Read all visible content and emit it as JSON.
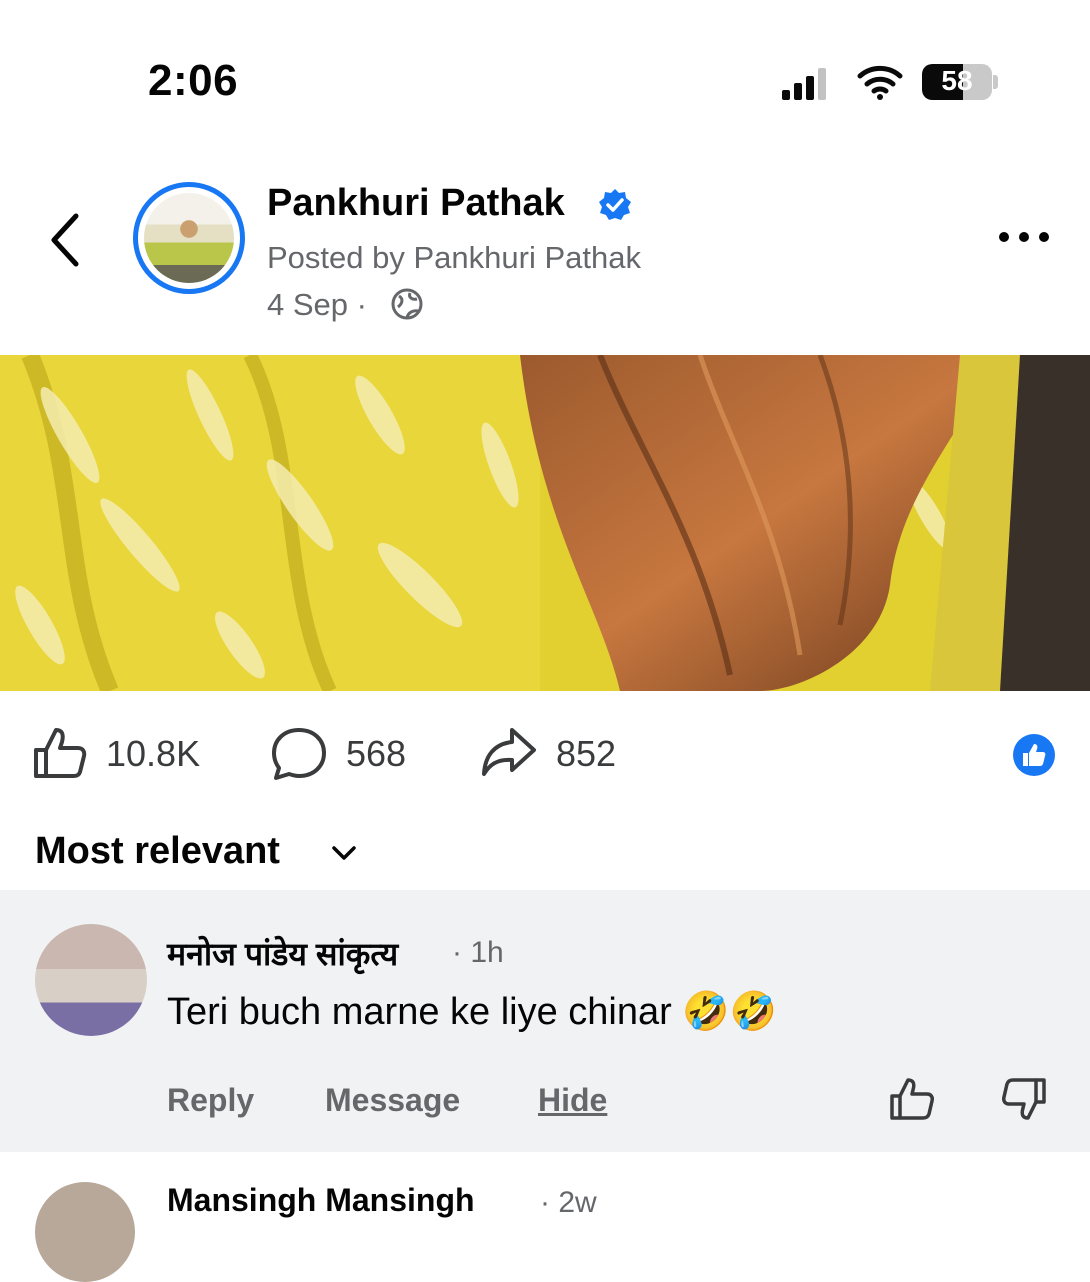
{
  "status_bar": {
    "time": "2:06",
    "battery": "58",
    "battery_level": 0.58,
    "icons": [
      "cellular-signal-icon",
      "wifi-icon",
      "battery-icon"
    ]
  },
  "header": {
    "page_name": "Pankhuri Pathak",
    "verified": true,
    "posted_by": "Posted by Pankhuri Pathak",
    "date": "4 Sep ·",
    "audience_icon": "globe-icon",
    "accent": "#1877f2"
  },
  "actions": {
    "likes": "10.8K",
    "comments": "568",
    "shares": "852"
  },
  "sort": {
    "label": "Most relevant"
  },
  "comments": [
    {
      "author": "मनोज पांडेय सांकृत्य",
      "time": "· 1h",
      "text": "Teri buch marne ke liye chinar 🤣🤣",
      "reply": "Reply",
      "message": "Message",
      "hide": "Hide"
    },
    {
      "author": "Mansingh Mansingh",
      "time": "· 2w"
    }
  ],
  "colors": {
    "text_secondary": "#65676b",
    "comment_bg": "#f1f2f4",
    "media_yellow": "#e4d236"
  }
}
